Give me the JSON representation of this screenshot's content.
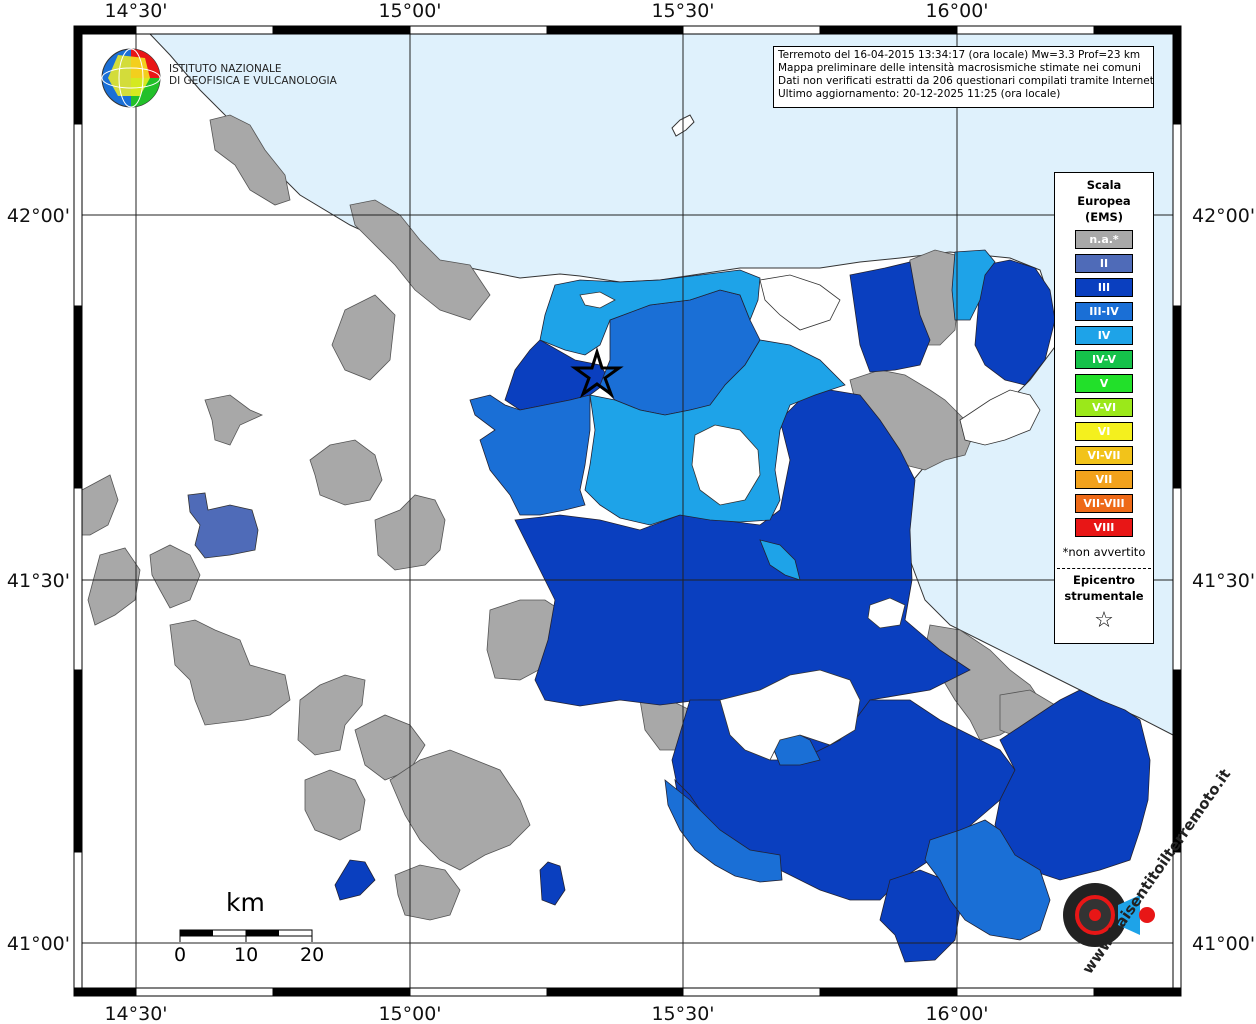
{
  "info": {
    "line1": "Terremoto del 16-04-2015 13:34:17 (ora locale) Mw=3.3 Prof=23 km",
    "line2": "Mappa preliminare delle intensità macrosismiche stimate nei comuni",
    "line3": "Dati non verificati estratti da 206 questionari compilati tramite Internet.",
    "line4": "Ultimo aggiornamento: 20-12-2025 11:25 (ora locale)"
  },
  "logo": {
    "line1": "ISTITUTO NAZIONALE",
    "line2": "DI GEOFISICA E VULCANOLOGIA"
  },
  "axes": {
    "top": [
      "14°30'",
      "15°00'",
      "15°30'",
      "16°00'"
    ],
    "bottom": [
      "14°30'",
      "15°00'",
      "15°30'",
      "16°00'"
    ],
    "left": [
      "42°00'",
      "41°30'",
      "41°00'"
    ],
    "right": [
      "42°00'",
      "41°30'",
      "41°00'"
    ]
  },
  "legend": {
    "title1": "Scala",
    "title2": "Europea",
    "title3": "(EMS)",
    "items": [
      {
        "label": "n.a.*",
        "color": "#a8a8a8"
      },
      {
        "label": "II",
        "color": "#4f6bb8"
      },
      {
        "label": "III",
        "color": "#0a3fbf"
      },
      {
        "label": "III-IV",
        "color": "#1a6fd6"
      },
      {
        "label": "IV",
        "color": "#1ea3e8"
      },
      {
        "label": "IV-V",
        "color": "#15c24a"
      },
      {
        "label": "V",
        "color": "#22e02a"
      },
      {
        "label": "V-VI",
        "color": "#9be81a"
      },
      {
        "label": "VI",
        "color": "#f4f01e"
      },
      {
        "label": "VI-VII",
        "color": "#f2c31a"
      },
      {
        "label": "VII",
        "color": "#f2a21c"
      },
      {
        "label": "VII-VIII",
        "color": "#ee6a18"
      },
      {
        "label": "VIII",
        "color": "#e81616"
      }
    ],
    "note": "*non avvertito",
    "epi1": "Epicentro",
    "epi2": "strumentale",
    "epi_symbol": "☆"
  },
  "scalebar": {
    "unit": "km",
    "ticks": [
      "0",
      "10",
      "20"
    ]
  },
  "colors": {
    "sea": "#dff1fc",
    "land": "#ffffff",
    "na": "#a8a8a8",
    "ems2": "#4f6bb8",
    "ems3": "#0a3fbf",
    "ems34": "#1a6fd6",
    "ems4": "#1ea3e8"
  },
  "watermark": "www.haisentitoilterremoto.it"
}
